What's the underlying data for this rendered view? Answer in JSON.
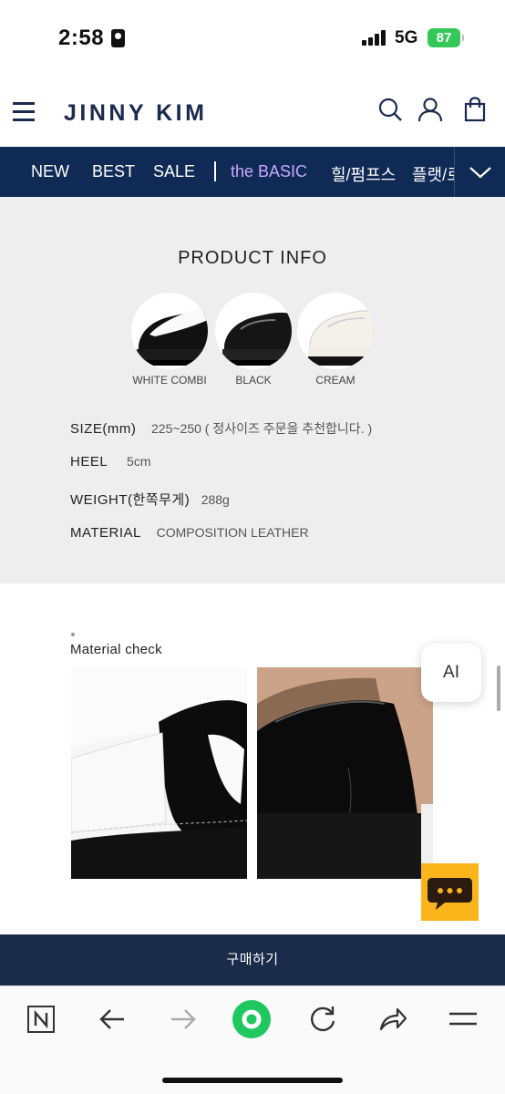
{
  "status_bar": {
    "time": "2:58",
    "network": "5G",
    "battery": "87"
  },
  "header": {
    "logo": "JINNY KIM"
  },
  "nav": {
    "items": [
      "NEW",
      "BEST",
      "SALE",
      "the BASIC",
      "힐/펌프스",
      "플랫/로"
    ],
    "highlight_color": "#c7a8ff"
  },
  "product_info": {
    "title": "PRODUCT INFO",
    "colors": [
      "WHITE COMBI",
      "BLACK",
      "CREAM"
    ],
    "specs": [
      {
        "label": "SIZE(mm)",
        "value": "225~250 ( 정사이즈 주문을 추천합니다. )"
      },
      {
        "label": "HEEL",
        "value": "5cm"
      },
      {
        "label": "WEIGHT(한쪽무게)",
        "value": "288g"
      },
      {
        "label": "MATERIAL",
        "value": "COMPOSITION LEATHER"
      }
    ]
  },
  "material": {
    "title": "Material check"
  },
  "floating": {
    "ai_label": "AI"
  },
  "buy_bar": {
    "label": "구매하기"
  },
  "colors": {
    "navy": "#102a56",
    "buy_bar": "#1a2c4a",
    "kakao": "#f9b51a",
    "browser_accent": "#1ec85f"
  }
}
